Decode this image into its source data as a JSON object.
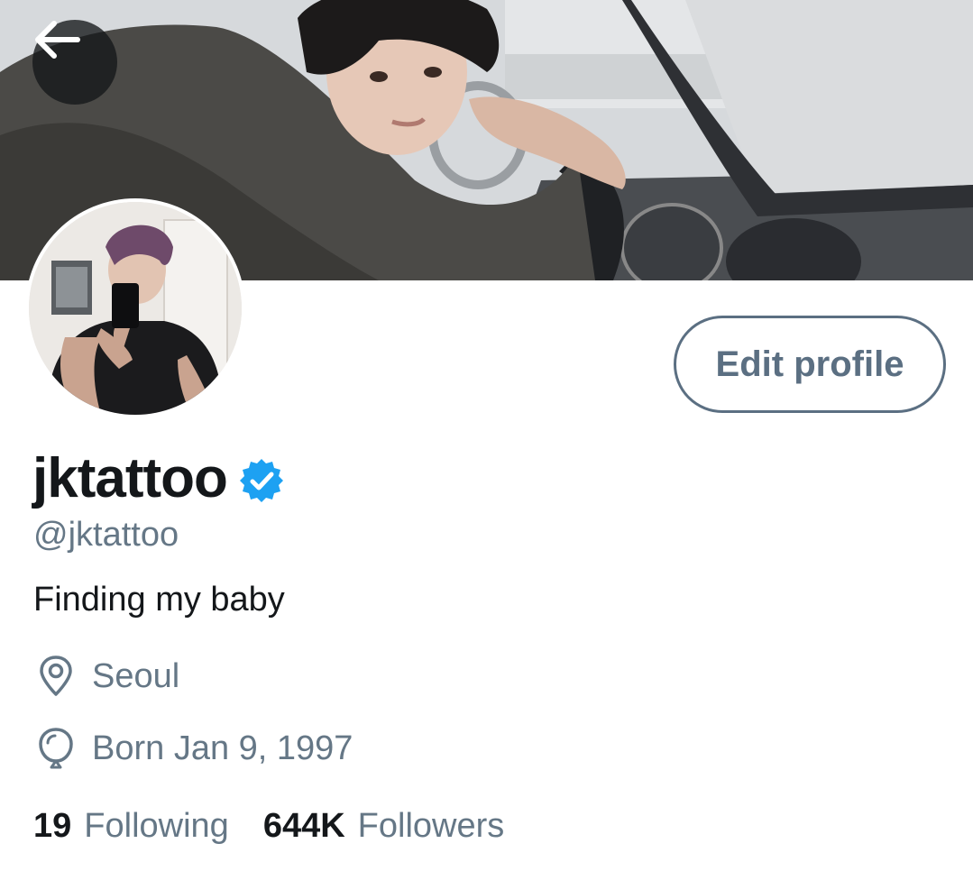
{
  "header": {
    "back_icon": "arrow-left-icon"
  },
  "profile": {
    "display_name": "jktattoo",
    "verified_icon": "verified-badge-icon",
    "handle": "@jktattoo",
    "bio": "Finding my baby",
    "location": "Seoul",
    "location_icon": "location-pin-icon",
    "birthday": "Born Jan 9, 1997",
    "birthday_icon": "balloon-icon",
    "edit_profile_label": "Edit profile"
  },
  "stats": {
    "following_count": "19",
    "following_label": "Following",
    "followers_count": "644K",
    "followers_label": "Followers"
  },
  "colors": {
    "accent": "#1da1f2",
    "muted_text": "#657786",
    "primary_text": "#14171a",
    "button_border": "#5b6f82"
  }
}
